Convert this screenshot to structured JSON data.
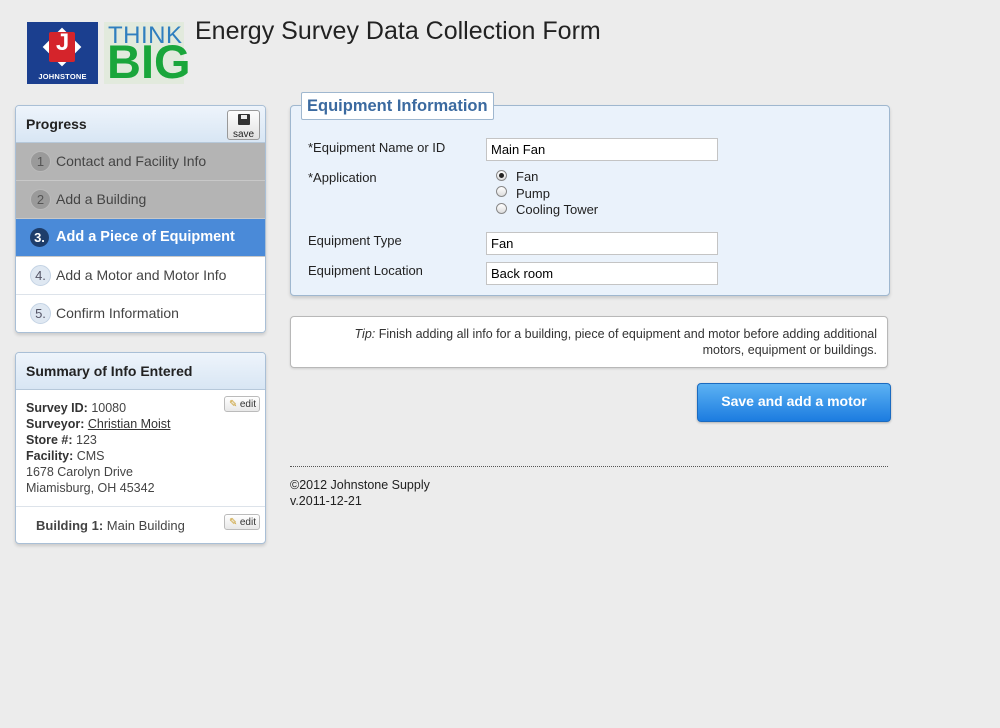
{
  "header": {
    "logo_brand": "JOHNSTONE",
    "logo_letter": "J",
    "logo_think": "THINK",
    "logo_big": "BIG",
    "title": "Energy Survey Data Collection Form"
  },
  "progress": {
    "title": "Progress",
    "save_label": "save",
    "steps": [
      {
        "num": "1",
        "label": "Contact and Facility Info",
        "state": "done"
      },
      {
        "num": "2",
        "label": "Add a Building",
        "state": "done"
      },
      {
        "num": "3.",
        "label": "Add a Piece of Equipment",
        "state": "active"
      },
      {
        "num": "4.",
        "label": "Add a Motor and Motor Info",
        "state": "todo"
      },
      {
        "num": "5.",
        "label": "Confirm Information",
        "state": "todo"
      }
    ]
  },
  "summary": {
    "title": "Summary of Info Entered",
    "edit_label": "edit",
    "survey_id_label": "Survey ID:",
    "survey_id": "10080",
    "surveyor_label": "Surveyor:",
    "surveyor": "Christian Moist",
    "store_label": "Store #:",
    "store": "123",
    "facility_label": "Facility:",
    "facility": "CMS",
    "address1": "1678 Carolyn Drive",
    "address2": "Miamisburg, OH 45342",
    "building_label": "Building 1:",
    "building": "Main Building"
  },
  "equipment": {
    "legend": "Equipment Information",
    "name_label": "*Equipment Name or ID",
    "name_value": "Main Fan",
    "application_label": "*Application",
    "application_options": [
      "Fan",
      "Pump",
      "Cooling Tower"
    ],
    "application_selected": "Fan",
    "type_label": "Equipment Type",
    "type_value": "Fan",
    "location_label": "Equipment Location",
    "location_value": "Back room"
  },
  "tip": {
    "prefix": "Tip:",
    "text": "Finish adding all info for a building, piece of equipment and motor before adding additional motors, equipment or buildings."
  },
  "actions": {
    "save_add_motor": "Save and add a motor"
  },
  "footer": {
    "copyright": "©2012 Johnstone Supply",
    "version": "v.2011-12-21"
  },
  "colors": {
    "accent_blue": "#4a8ad8",
    "button_blue": "#1c7ce0",
    "legend_blue": "#3b6aa0",
    "logo_navy": "#1b3f8f",
    "logo_red": "#d5242b",
    "logo_green": "#1aa63b"
  }
}
